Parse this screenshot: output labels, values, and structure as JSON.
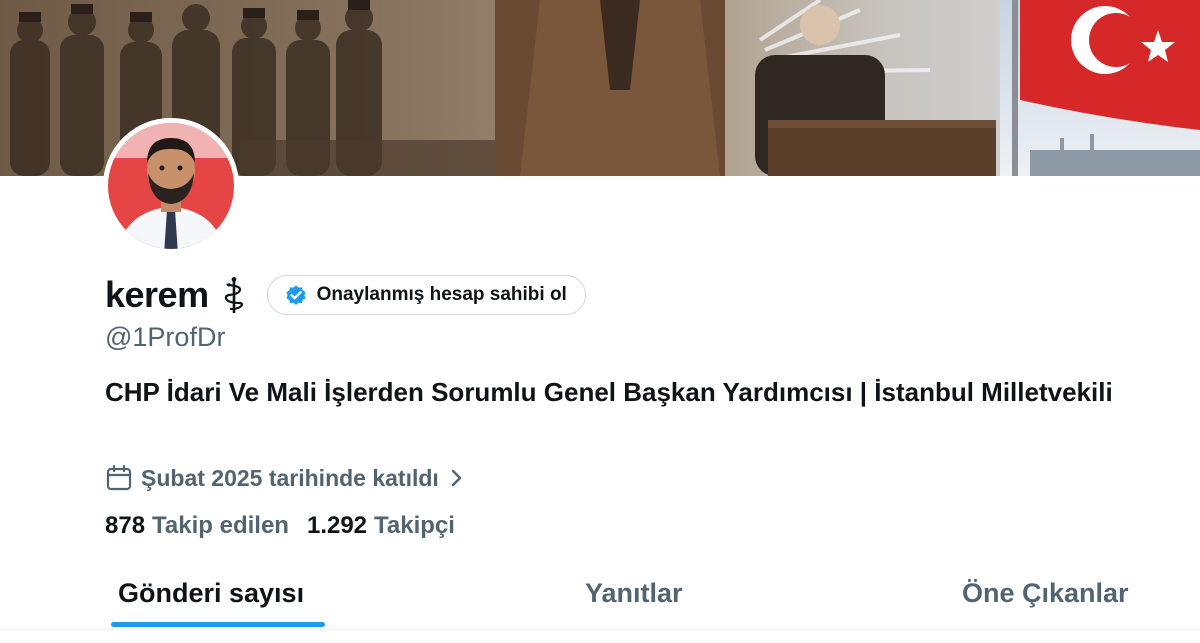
{
  "profile": {
    "display_name": "kerem",
    "handle": "@1ProfDr",
    "verify_cta": "Onaylanmış hesap sahibi ol",
    "bio": "CHP İdari Ve Mali İşlerden Sorumlu Genel Başkan Yardımcısı | İstanbul Milletvekili",
    "joined": "Şubat 2025 tarihinde katıldı"
  },
  "stats": {
    "following_count": "878",
    "following_label": "Takip edilen",
    "followers_count": "1.292",
    "followers_label": "Takipçi"
  },
  "tabs": [
    {
      "label": "Gönderi sayısı",
      "active": true
    },
    {
      "label": "Yanıtlar",
      "active": false
    },
    {
      "label": "Öne Çıkanlar",
      "active": false
    }
  ],
  "icons": {
    "name_emoji": "staff-of-aesculapius-icon",
    "verify": "verified-badge-icon",
    "joined": "calendar-icon",
    "joined_more": "chevron-right-icon"
  },
  "colors": {
    "accent": "#1d9bf0",
    "text_primary": "#0f1419",
    "text_secondary": "#536471",
    "border": "#cfd9de"
  }
}
